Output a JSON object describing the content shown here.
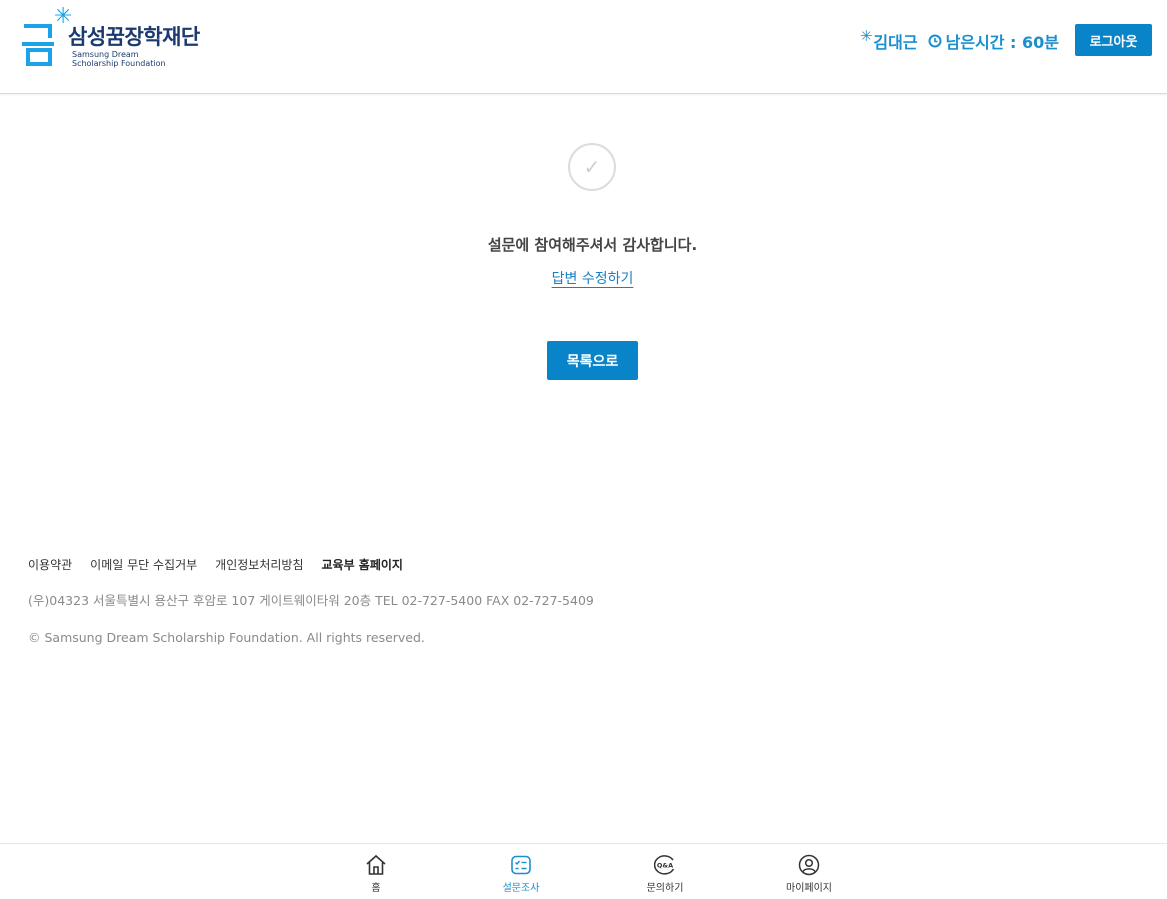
{
  "header": {
    "logo_text_ko": "삼성꿈장학재단",
    "logo_text_en_line1": "Samsung Dream",
    "logo_text_en_line2": "Scholarship Foundation",
    "user_name": "김대근",
    "time_label": "남은시간 : 60분",
    "logout_label": "로그아웃"
  },
  "main": {
    "thanks_message": "설문에 참여해주셔서 감사합니다.",
    "edit_link_label": "답변 수정하기",
    "list_button_label": "목록으로"
  },
  "footer": {
    "links": [
      "이용약관",
      "이메일 무단 수집거부",
      "개인정보처리방침",
      "교육부 홈페이지"
    ],
    "address": "(우)04323 서울특별시 용산구 후암로 107 게이트웨이타워 20층 TEL 02-727-5400 FAX 02-727-5409",
    "copyright": "© Samsung Dream Scholarship Foundation. All rights reserved."
  },
  "bottom_nav": {
    "items": [
      {
        "label": "홈",
        "icon": "home-icon",
        "active": false
      },
      {
        "label": "설문조사",
        "icon": "survey-icon",
        "active": true
      },
      {
        "label": "문의하기",
        "icon": "qna-icon",
        "active": false
      },
      {
        "label": "마이페이지",
        "icon": "user-icon",
        "active": false
      }
    ]
  },
  "colors": {
    "primary": "#0a84c8",
    "accent_text": "#1a8fd0",
    "logo_navy": "#1b3a70",
    "logo_star": "#1aa3e8"
  }
}
